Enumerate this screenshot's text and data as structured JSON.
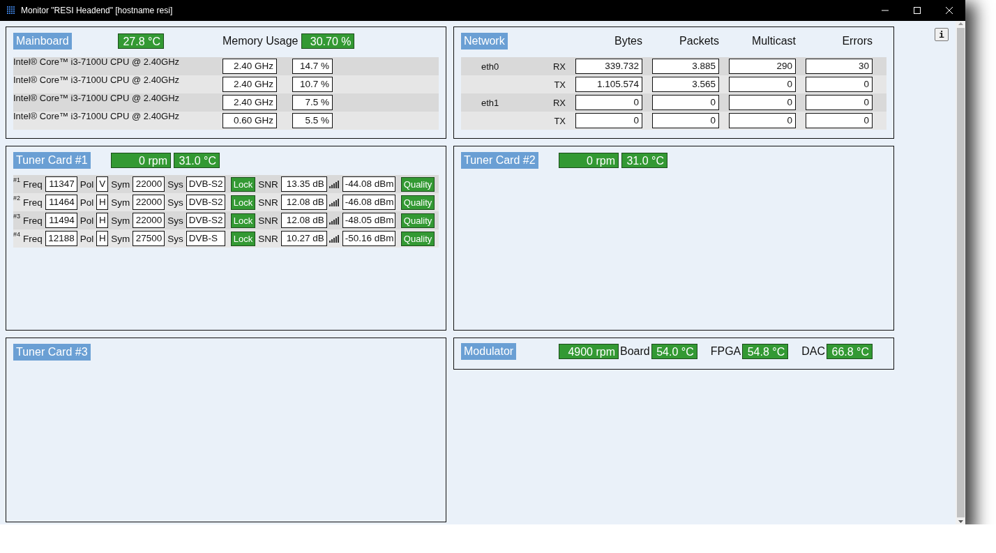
{
  "window": {
    "title": "Monitor \"RESI Headend\" [hostname resi]"
  },
  "info_button": "i",
  "mainboard": {
    "title": "Mainboard",
    "temperature": "27.8 °C",
    "memory_label": "Memory Usage",
    "memory_usage": "30.70 %",
    "cpus": [
      {
        "name": "Intel® Core™ i3-7100U CPU @ 2.40GHz",
        "frequency": "2.40 GHz",
        "usage": "14.7 %"
      },
      {
        "name": "Intel® Core™ i3-7100U CPU @ 2.40GHz",
        "frequency": "2.40 GHz",
        "usage": "10.7 %"
      },
      {
        "name": "Intel® Core™ i3-7100U CPU @ 2.40GHz",
        "frequency": "2.40 GHz",
        "usage": "7.5 %"
      },
      {
        "name": "Intel® Core™ i3-7100U CPU @ 2.40GHz",
        "frequency": "0.60 GHz",
        "usage": "5.5 %"
      }
    ]
  },
  "network": {
    "title": "Network",
    "columns": [
      "Bytes",
      "Packets",
      "Multicast",
      "Errors"
    ],
    "rows": [
      {
        "interface": "eth0",
        "direction": "RX",
        "values": [
          "339.732",
          "3.885",
          "290",
          "30"
        ]
      },
      {
        "direction": "TX",
        "values": [
          "1.105.574",
          "3.565",
          "0",
          "0"
        ]
      },
      {
        "interface": "eth1",
        "direction": "RX",
        "values": [
          "0",
          "0",
          "0",
          "0"
        ]
      },
      {
        "direction": "TX",
        "values": [
          "0",
          "0",
          "0",
          "0"
        ]
      }
    ]
  },
  "tuner_cards": [
    {
      "title": "Tuner Card #1",
      "fan": "0 rpm",
      "temperature": "31.0 °C",
      "channels": [
        {
          "number": "#1",
          "freq_label": "Freq",
          "freq": "11347",
          "pol_label": "Pol",
          "pol": "V",
          "sym_label": "Sym",
          "sym": "22000",
          "sys_label": "Sys",
          "sys": "DVB-S2",
          "lock": "Lock",
          "locked": true,
          "snr_label": "SNR",
          "snr": "13.35 dB",
          "signal": "-44.08 dBm",
          "quality": "Quality"
        },
        {
          "number": "#2",
          "freq_label": "Freq",
          "freq": "11464",
          "pol_label": "Pol",
          "pol": "H",
          "sym_label": "Sym",
          "sym": "22000",
          "sys_label": "Sys",
          "sys": "DVB-S2",
          "lock": "Lock",
          "locked": true,
          "snr_label": "SNR",
          "snr": "12.08 dB",
          "signal": "-46.08 dBm",
          "quality": "Quality"
        },
        {
          "number": "#3",
          "freq_label": "Freq",
          "freq": "11494",
          "pol_label": "Pol",
          "pol": "H",
          "sym_label": "Sym",
          "sym": "22000",
          "sys_label": "Sys",
          "sys": "DVB-S2",
          "lock": "Lock",
          "locked": true,
          "snr_label": "SNR",
          "snr": "12.08 dB",
          "signal": "-48.05 dBm",
          "quality": "Quality"
        },
        {
          "number": "#4",
          "freq_label": "Freq",
          "freq": "12188",
          "pol_label": "Pol",
          "pol": "H",
          "sym_label": "Sym",
          "sym": "27500",
          "sys_label": "Sys",
          "sys": "DVB-S",
          "lock": "Lock",
          "locked": true,
          "snr_label": "SNR",
          "snr": "10.27 dB",
          "signal": "-50.16 dBm",
          "quality": "Quality"
        }
      ]
    },
    {
      "title": "Tuner Card #2",
      "fan": "0 rpm",
      "temperature": "31.0 °C"
    },
    {
      "title": "Tuner Card #3"
    }
  ],
  "modulator": {
    "title": "Modulator",
    "fan": "4900 rpm",
    "readings": [
      {
        "label": "Board",
        "value": "54.0 °C"
      },
      {
        "label": "FPGA",
        "value": "54.8 °C"
      },
      {
        "label": "DAC",
        "value": "66.8 °C"
      }
    ]
  }
}
